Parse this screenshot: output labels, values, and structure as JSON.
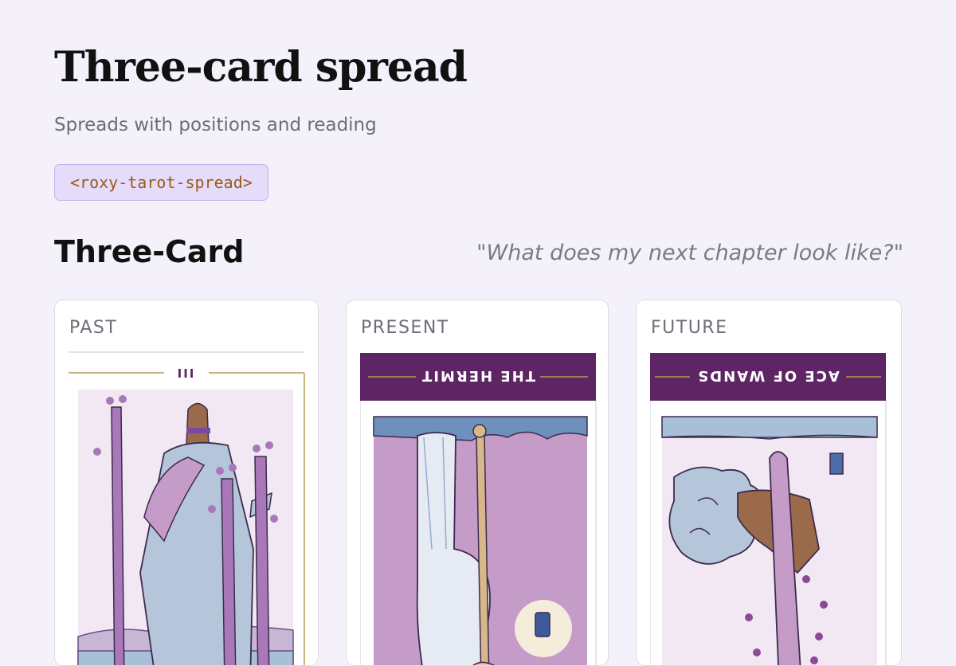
{
  "header": {
    "title": "Three-card spread",
    "subtitle": "Spreads with positions and reading",
    "tag": "<roxy-tarot-spread>"
  },
  "spread": {
    "name": "Three-Card",
    "question": "\"What does my next chapter look like?\"",
    "cards": [
      {
        "position": "PAST",
        "card_name": "",
        "numeral": "III",
        "reversed": false
      },
      {
        "position": "PRESENT",
        "card_name": "THE HERMIT",
        "numeral": "",
        "reversed": true
      },
      {
        "position": "FUTURE",
        "card_name": "ACE OF WANDS",
        "numeral": "",
        "reversed": true
      }
    ]
  },
  "colors": {
    "background": "#f4f1fb",
    "card_banner": "#5e2565",
    "card_gold": "#b59a5a",
    "wand_purple": "#a878b8",
    "art_lilac": "#c59bc8",
    "robe_blue": "#b5c6da"
  }
}
